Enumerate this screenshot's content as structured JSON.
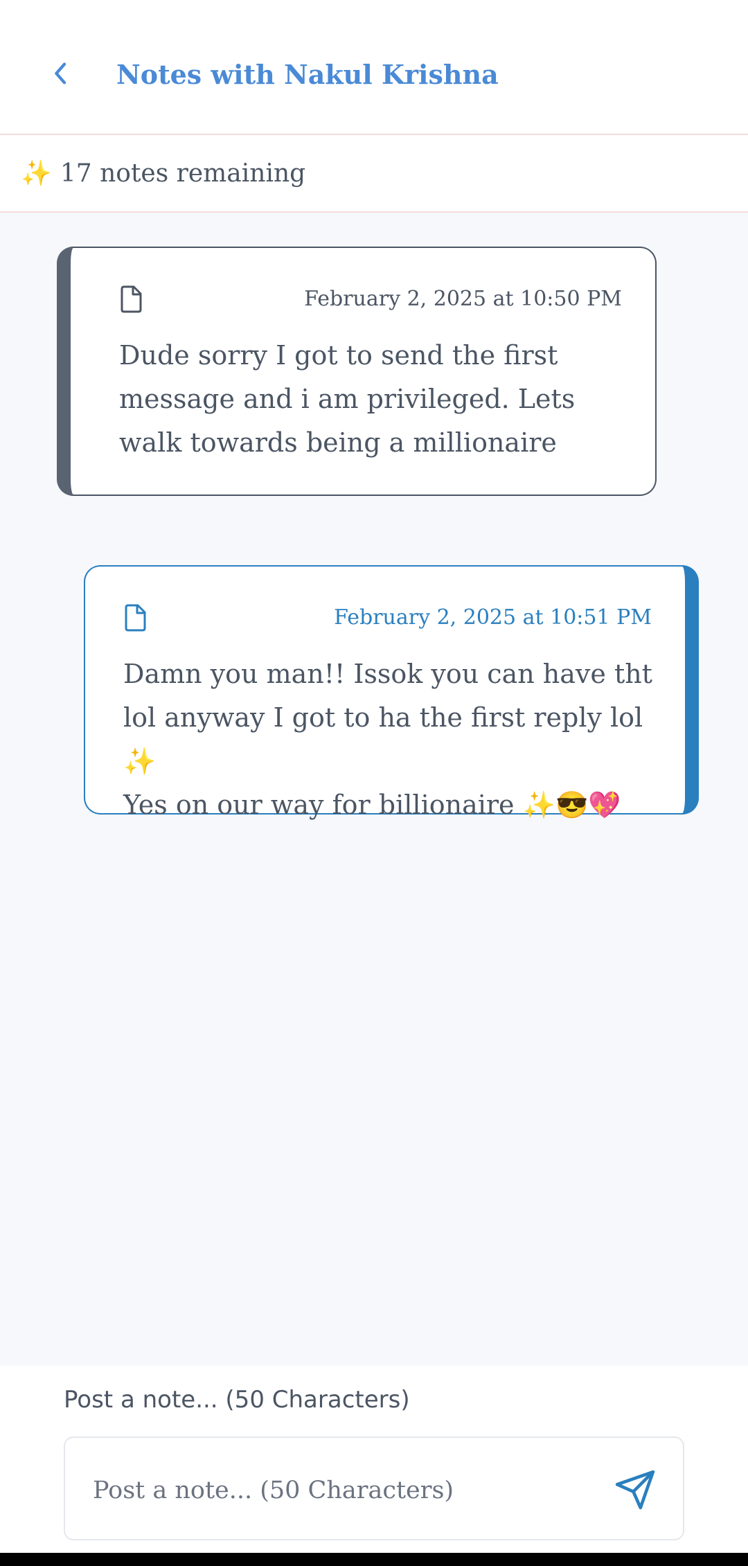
{
  "header": {
    "title": "Notes with Nakul Krishna",
    "back_icon": "chevron-left-icon"
  },
  "status": {
    "sparkle": "✨",
    "remaining_text": "17 notes remaining"
  },
  "notes": [
    {
      "direction": "received",
      "icon": "file-icon",
      "timestamp": "February 2, 2025 at 10:50 PM",
      "text": "Dude sorry I got to send the first message and i am privileged. Lets walk towards being a millionaire"
    },
    {
      "direction": "sent",
      "icon": "file-icon",
      "timestamp": "February 2, 2025 at 10:51 PM",
      "text": "Damn you man!! Issok you can have tht lol anyway I got to ha the first reply lol ✨\nYes on our way for billionaire ✨😎💖"
    }
  ],
  "composer": {
    "label": "Post a note... (50 Characters)",
    "placeholder": "Post a note... (50 Characters)",
    "value": "",
    "send_icon": "send-icon"
  },
  "colors": {
    "accent": "#4a8ad6",
    "sent": "#2a7fbf",
    "received": "#5a6372",
    "background": "#f6f8fb",
    "divider": "#f6dcdc"
  }
}
